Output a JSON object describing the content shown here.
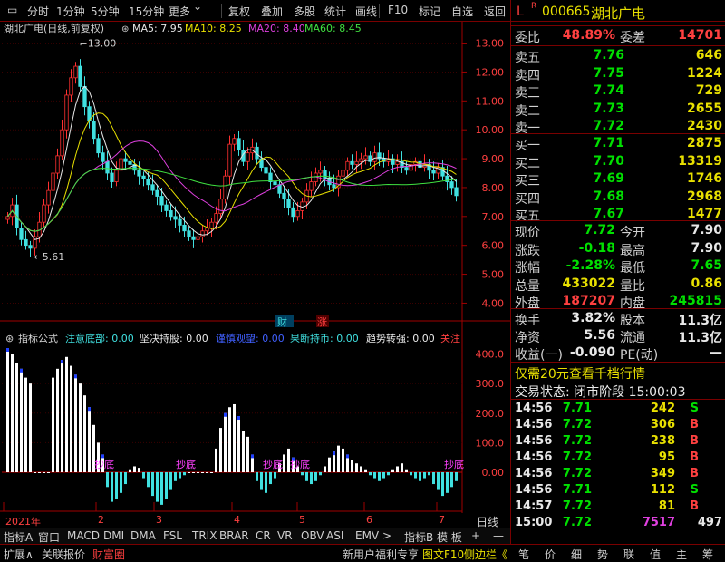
{
  "toolbar": {
    "items": [
      "分时",
      "1分钟",
      "5分钟",
      "15分钟",
      "更多",
      "复权",
      "叠加",
      "多股",
      "统计",
      "画线",
      "F10",
      "标记",
      "自选",
      "返回"
    ]
  },
  "chart": {
    "title": "湖北广电(日线,前复权)",
    "ma": [
      {
        "label": "MA5: 7.95",
        "color": "#e8e8e8"
      },
      {
        "label": "MA10: 8.25",
        "color": "#e8e000"
      },
      {
        "label": "MA20: 8.40",
        "color": "#e040e0"
      },
      {
        "label": "MA60: 8.45",
        "color": "#40e040"
      }
    ],
    "price_axis": [
      "13.00",
      "12.00",
      "11.00",
      "10.00",
      "9.00",
      "8.00",
      "7.00",
      "6.00",
      "5.00",
      "4.00"
    ],
    "high_label": "13.00",
    "low_label": "5.61",
    "badge_cai": "财",
    "badge_zhang": "涨",
    "ind_name": "指标公式",
    "ind_items": [
      {
        "label": "注意底部: 0.00",
        "color": "#40e0e0"
      },
      {
        "label": "坚决持股: 0.00",
        "color": "#e8e8e8"
      },
      {
        "label": "谨慎观望: 0.00",
        "color": "#4060ff"
      },
      {
        "label": "果断持币: 0.00",
        "color": "#40e0e0"
      },
      {
        "label": "趋势转强: 0.00",
        "color": "#e8e8e8"
      },
      {
        "label": "关注",
        "color": "#ff4040"
      }
    ],
    "ind_axis": [
      "400.0",
      "300.0",
      "200.0",
      "100.0",
      "0.00"
    ],
    "time_axis": [
      "2021年",
      "2",
      "3",
      "4",
      "5",
      "6",
      "7"
    ],
    "signal": "抄底"
  },
  "bottom_tabs": [
    "指标A",
    "窗口",
    "MACD",
    "DMI",
    "DMA",
    "FSL",
    "TRIX",
    "BRAR",
    "CR",
    "VR",
    "OBV",
    "ASI",
    "EMV",
    ">",
    "指标B",
    "模 板",
    "+",
    "—",
    "日线"
  ],
  "bottom_bar": {
    "left": [
      "扩展∧",
      "关联报价",
      "财富圈"
    ],
    "promo": "新用户福利专享",
    "f10": "图文F10",
    "side": "侧边栏《",
    "right": [
      "笔",
      "价",
      "细",
      "势",
      "联",
      "值",
      "主",
      "筹"
    ]
  },
  "quote": {
    "code": "000665",
    "name": "湖北广电",
    "weibi_label": "委比",
    "weibi": "48.89%",
    "weicha_label": "委差",
    "weicha": "14701",
    "sell": [
      {
        "label": "卖五",
        "price": "7.76",
        "vol": "646"
      },
      {
        "label": "卖四",
        "price": "7.75",
        "vol": "1224"
      },
      {
        "label": "卖三",
        "price": "7.74",
        "vol": "729"
      },
      {
        "label": "卖二",
        "price": "7.73",
        "vol": "2655"
      },
      {
        "label": "卖一",
        "price": "7.72",
        "vol": "2430"
      }
    ],
    "buy": [
      {
        "label": "买一",
        "price": "7.71",
        "vol": "2875"
      },
      {
        "label": "买二",
        "price": "7.70",
        "vol": "13319"
      },
      {
        "label": "买三",
        "price": "7.69",
        "vol": "1746"
      },
      {
        "label": "买四",
        "price": "7.68",
        "vol": "2968"
      },
      {
        "label": "买五",
        "price": "7.67",
        "vol": "1477"
      }
    ],
    "stats": [
      {
        "l1": "现价",
        "v1": "7.72",
        "c1": "green",
        "l2": "今开",
        "v2": "7.90",
        "c2": "white"
      },
      {
        "l1": "涨跌",
        "v1": "-0.18",
        "c1": "green",
        "l2": "最高",
        "v2": "7.90",
        "c2": "white"
      },
      {
        "l1": "涨幅",
        "v1": "-2.28%",
        "c1": "green",
        "l2": "最低",
        "v2": "7.65",
        "c2": "green"
      },
      {
        "l1": "总量",
        "v1": "433022",
        "c1": "yellow",
        "l2": "量比",
        "v2": "0.86",
        "c2": "yellow"
      },
      {
        "l1": "外盘",
        "v1": "187207",
        "c1": "red",
        "l2": "内盘",
        "v2": "245815",
        "c2": "green"
      }
    ],
    "stats2": [
      {
        "l1": "换手",
        "v1": "3.82%",
        "c1": "white",
        "l2": "股本",
        "v2": "11.3亿",
        "c2": "white"
      },
      {
        "l1": "净资",
        "v1": "5.56",
        "c1": "white",
        "l2": "流通",
        "v2": "11.3亿",
        "c2": "white"
      },
      {
        "l1": "收益(一)",
        "v1": "-0.090",
        "c1": "white",
        "l2": "PE(动)",
        "v2": "—",
        "c2": "white"
      }
    ],
    "promo": "仅需20元查看千档行情",
    "status": "交易状态: 闭市阶段 15:00:03",
    "ticks": [
      {
        "t": "14:56",
        "p": "7.71",
        "v": "242",
        "s": "S"
      },
      {
        "t": "14:56",
        "p": "7.72",
        "v": "306",
        "s": "B"
      },
      {
        "t": "14:56",
        "p": "7.72",
        "v": "238",
        "s": "B"
      },
      {
        "t": "14:56",
        "p": "7.72",
        "v": "95",
        "s": "B"
      },
      {
        "t": "14:56",
        "p": "7.72",
        "v": "349",
        "s": "B"
      },
      {
        "t": "14:56",
        "p": "7.71",
        "v": "112",
        "s": "S"
      },
      {
        "t": "14:57",
        "p": "7.72",
        "v": "81",
        "s": "B"
      },
      {
        "t": "15:00",
        "p": "7.72",
        "v": "7517",
        "s": "497"
      }
    ]
  },
  "chart_data": [
    {
      "type": "candlestick",
      "ylim": [
        3.7,
        13.3
      ],
      "close": [
        7.0,
        7.4,
        6.6,
        6.2,
        6.0,
        5.9,
        6.3,
        6.8,
        7.4,
        7.9,
        8.5,
        9.1,
        10.0,
        11.2,
        11.8,
        12.2,
        11.5,
        10.8,
        10.3,
        9.7,
        9.2,
        8.9,
        8.5,
        8.2,
        8.6,
        9.0,
        8.9,
        8.8,
        8.6,
        8.4,
        8.3,
        8.1,
        7.9,
        7.7,
        7.4,
        7.2,
        7.0,
        6.9,
        6.7,
        6.5,
        6.3,
        6.2,
        6.3,
        6.5,
        6.6,
        6.8,
        7.1,
        7.6,
        8.4,
        9.5,
        9.7,
        9.3,
        8.9,
        9.2,
        9.4,
        9.0,
        8.7,
        8.5,
        8.2,
        8.1,
        7.8,
        7.6,
        7.3,
        7.0,
        7.2,
        7.5,
        7.9,
        8.2,
        8.5,
        8.6,
        8.3,
        8.1,
        8.0,
        8.4,
        8.6,
        8.9,
        8.8,
        8.9,
        9.0,
        9.1,
        8.9,
        9.2,
        9.0,
        8.9,
        9.0,
        8.8,
        8.9,
        8.7,
        8.6,
        8.8,
        8.9,
        8.7,
        8.8,
        8.6,
        8.5,
        8.7,
        8.4,
        8.2,
        8.0,
        7.72
      ]
    },
    {
      "type": "bar",
      "name": "indicator",
      "values": [
        420,
        400,
        370,
        350,
        320,
        300,
        0,
        0,
        0,
        0,
        320,
        350,
        380,
        390,
        360,
        330,
        300,
        260,
        220,
        160,
        100,
        60,
        -50,
        -100,
        -90,
        -70,
        -40,
        10,
        20,
        15,
        -20,
        -50,
        -80,
        -100,
        -110,
        -90,
        -60,
        -30,
        -20,
        -10,
        0,
        0,
        0,
        0,
        0,
        0,
        80,
        150,
        200,
        220,
        230,
        190,
        140,
        120,
        60,
        -30,
        -60,
        -70,
        -40,
        -20,
        30,
        60,
        80,
        50,
        20,
        -10,
        -30,
        -40,
        -30,
        -10,
        20,
        50,
        70,
        90,
        80,
        60,
        40,
        30,
        20,
        10,
        -10,
        -20,
        -30,
        -20,
        -10,
        10,
        20,
        30,
        10,
        -10,
        -20,
        -30,
        -20,
        -10,
        -40,
        -60,
        -80,
        -70,
        -50,
        -30
      ]
    }
  ]
}
